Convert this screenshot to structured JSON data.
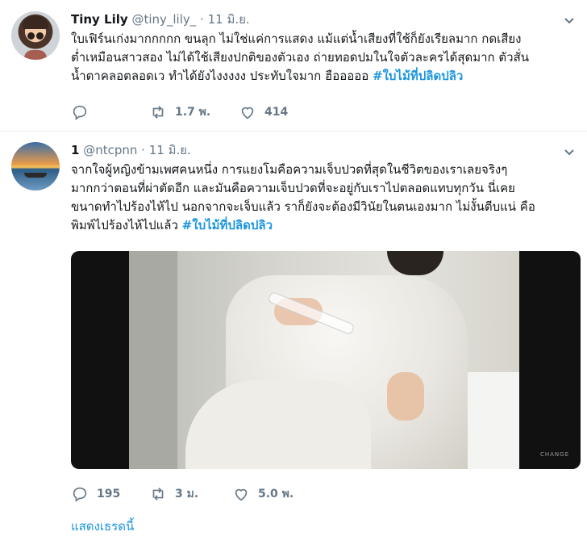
{
  "tweets": [
    {
      "name": "Tiny Lily",
      "handle": "@tiny_lily_",
      "separator": "·",
      "time": "11 มิ.ย.",
      "text": "ใบเฟิร์นเก่งมากกกกก ขนลุก ไม่ใช่แค่การแสดง แม้แต่น้ำเสียงที่ใช้ก็ยังเรียลมาก กดเสียง\nต่ำเหมือนสาวสอง ไม่ได้ใช้เสียงปกติของตัวเอง ถ่ายทอดปมในใจตัวละครได้สุดมาก ตัวสั่น\nน้ำตาคลอตลอดเว ทำได้ยังไงงงงง ประทับใจมาก ฮือออออ ",
      "hashtag": "#ใบไม้ที่ปลิดปลิว",
      "replies": "",
      "retweets": "1.7 พ.",
      "likes": "414"
    },
    {
      "name": "1",
      "handle": "@ntcpnn",
      "separator": "·",
      "time": "11 มิ.ย.",
      "text": "จากใจผู้หญิงข้ามเพศคนหนึ่ง การแยงโมคือความเจ็บปวดที่สุดในชีวิตของเราเลยจริงๆ\nมากกว่าตอนที่ผ่าตัดอีก และมันคือความเจ็บปวดที่จะอยู่กับเราไปตลอดแทบทุกวัน นี่เคย\nขนาดทำไปร้องไห้ไป นอกจากจะเจ็บแล้ว ราก็ยังจะต้องมีวินัยในตนเองมาก ไม่งั้นตีบแน่ คือ\nพิมพ์ไปร้องไห้ไปแล้ว ",
      "hashtag": "#ใบไม้ที่ปลิดปลิว",
      "replies": "195",
      "retweets": "3 ม.",
      "likes": "5.0 พ.",
      "media_watermark": "CHANGE"
    }
  ],
  "show_thread": "แสดงเธรดนี้",
  "icons": [
    "reply-icon",
    "retweet-icon",
    "like-icon",
    "chevron-down-icon"
  ],
  "colors": {
    "link": "#1b95e0",
    "muted": "#657786",
    "text": "#14171a"
  }
}
